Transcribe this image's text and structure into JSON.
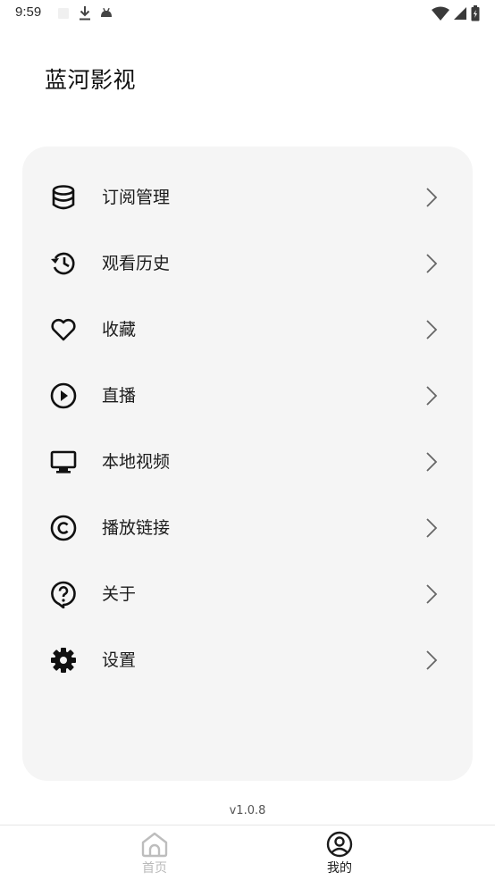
{
  "status_bar": {
    "time": "9:59",
    "left_icons": [
      "blank-square-icon",
      "download-icon",
      "android-icon"
    ],
    "right_icons": [
      "wifi-icon",
      "signal-icon",
      "battery-icon"
    ]
  },
  "app": {
    "title": "蓝河影视"
  },
  "menu": {
    "items": [
      {
        "label": "订阅管理",
        "icon": "database-icon"
      },
      {
        "label": "观看历史",
        "icon": "history-icon"
      },
      {
        "label": "收藏",
        "icon": "heart-icon"
      },
      {
        "label": "直播",
        "icon": "play-circle-icon"
      },
      {
        "label": "本地视频",
        "icon": "monitor-icon"
      },
      {
        "label": "播放链接",
        "icon": "copyright-icon"
      },
      {
        "label": "关于",
        "icon": "question-icon"
      },
      {
        "label": "设置",
        "icon": "gear-icon"
      }
    ]
  },
  "version": "v1.0.8",
  "bottom_nav": {
    "items": [
      {
        "label": "首页",
        "icon": "home-icon",
        "active": false
      },
      {
        "label": "我的",
        "icon": "user-circle-icon",
        "active": true
      }
    ]
  },
  "colors": {
    "card_background": "#f5f5f5",
    "active_nav": "#1c1c1c",
    "inactive_nav": "#b9b9b9"
  }
}
